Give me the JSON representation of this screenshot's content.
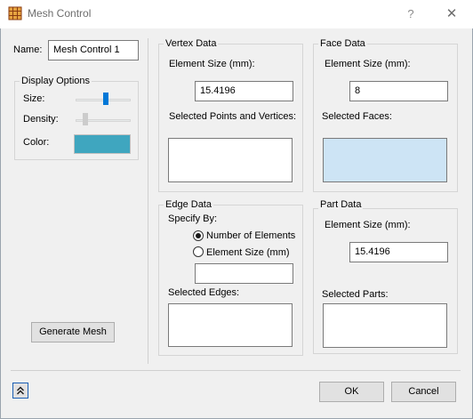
{
  "window": {
    "title": "Mesh Control",
    "help_label": "?",
    "close_label": "✕"
  },
  "name_field": {
    "label": "Name:",
    "value": "Mesh Control 1"
  },
  "display_options": {
    "title": "Display Options",
    "size_label": "Size:",
    "size_level": 0.55,
    "density_label": "Density:",
    "density_level": 0.15,
    "color_label": "Color:",
    "color_value": "#3fa6bf"
  },
  "generate_button": "Generate Mesh",
  "vertex_data": {
    "title": "Vertex Data",
    "element_size_label": "Element Size (mm):",
    "element_size_value": "15.4196",
    "selected_label": "Selected Points and Vertices:"
  },
  "face_data": {
    "title": "Face Data",
    "element_size_label": "Element Size (mm):",
    "element_size_value": "8",
    "selected_label": "Selected Faces:",
    "selected_color": "#cde4f5"
  },
  "edge_data": {
    "title": "Edge Data",
    "specify_by_label": "Specify By:",
    "option_elements": "Number of Elements",
    "option_size": "Element Size (mm)",
    "selected_option": "Number of Elements",
    "value": "",
    "selected_label": "Selected Edges:"
  },
  "part_data": {
    "title": "Part Data",
    "element_size_label": "Element Size (mm):",
    "element_size_value": "15.4196",
    "selected_label": "Selected Parts:"
  },
  "footer": {
    "ok_label": "OK",
    "cancel_label": "Cancel",
    "expand_icon": "double-chevron-up-icon"
  }
}
